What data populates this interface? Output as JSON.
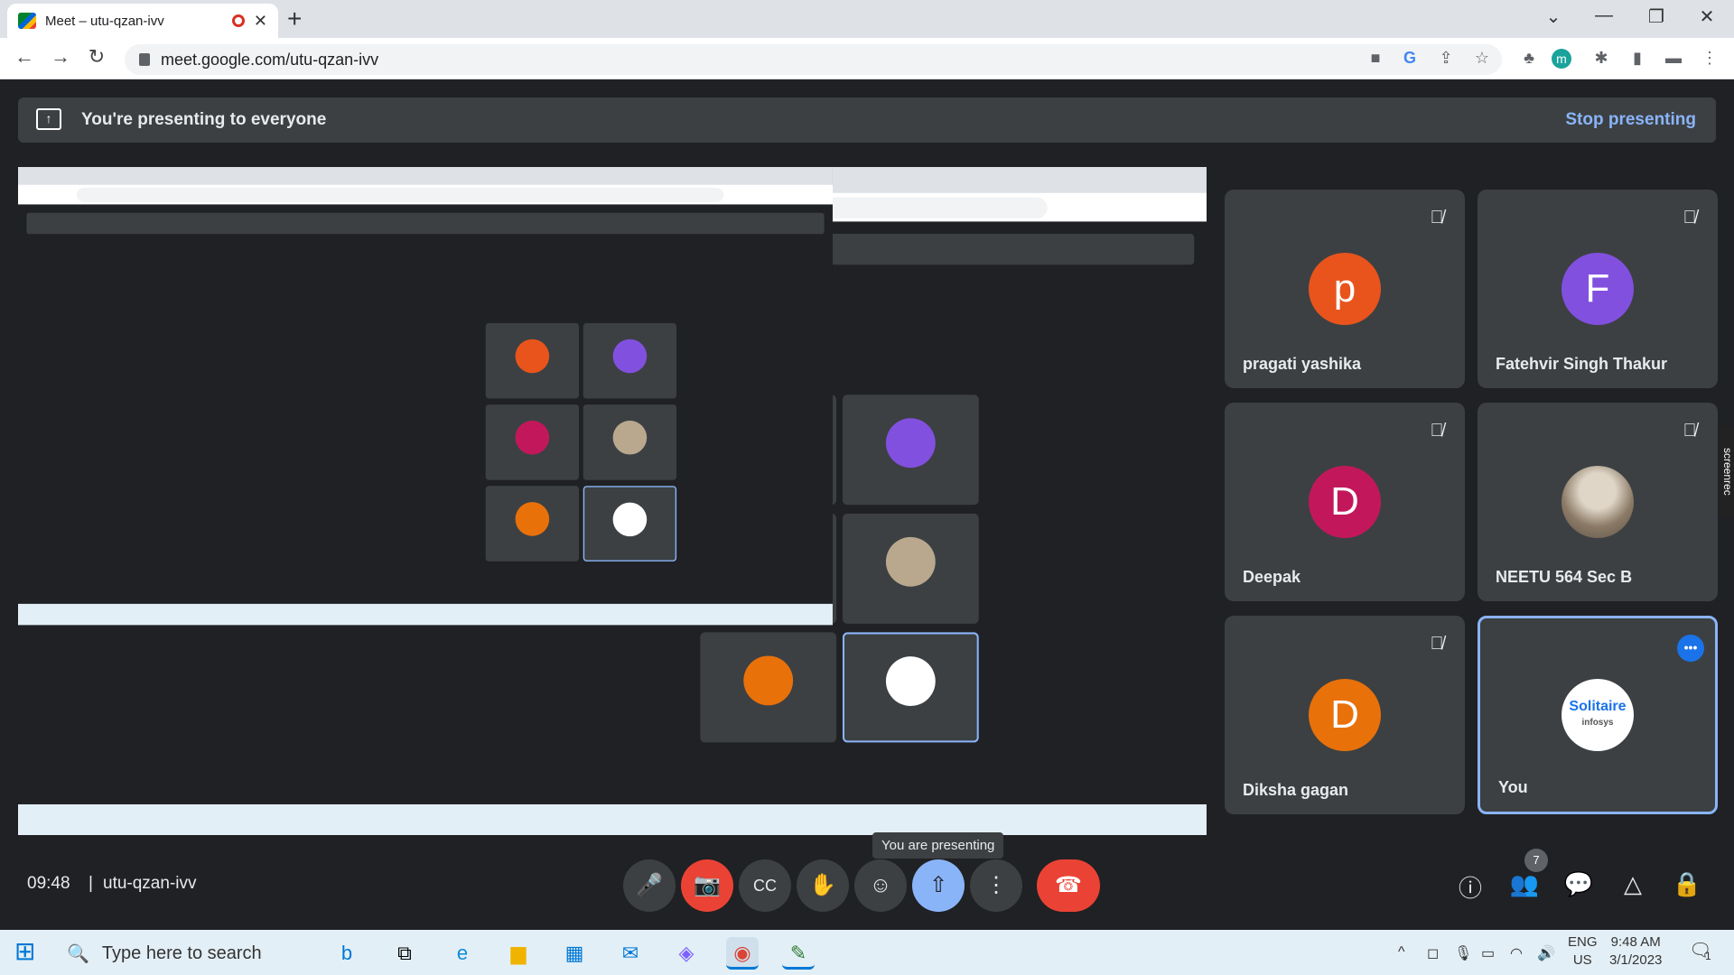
{
  "browser": {
    "tab_title": "Meet – utu-qzan-ivv",
    "url": "meet.google.com/utu-qzan-ivv"
  },
  "banner": {
    "text": "You're presenting to everyone",
    "stop": "Stop presenting"
  },
  "participants": [
    {
      "name": "pragati yashika",
      "initial": "p",
      "color": "#e8541c",
      "muted": true
    },
    {
      "name": "Fatehvir Singh Thakur",
      "initial": "F",
      "color": "#8250df",
      "muted": true
    },
    {
      "name": "Deepak",
      "initial": "D",
      "color": "#c2185b",
      "muted": true
    },
    {
      "name": "NEETU 564 Sec B",
      "initial": "",
      "color": "#b9a88e",
      "muted": true
    },
    {
      "name": "Diksha gagan",
      "initial": "D",
      "color": "#e8710a",
      "muted": true
    },
    {
      "name": "You",
      "initial": "",
      "color": "#ffffff",
      "muted": false
    }
  ],
  "you_logo": {
    "title": "Solitaire",
    "sub": "infosys"
  },
  "bottom": {
    "time": "09:48",
    "separator": "|",
    "meeting_code": "utu-qzan-ivv",
    "tooltip": "You are presenting",
    "people_count": "7"
  },
  "taskbar": {
    "search_placeholder": "Type here to search",
    "lang1": "ENG",
    "lang2": "US",
    "time": "9:48 AM",
    "date": "3/1/2023",
    "notifications": "1"
  },
  "screenrec": "screenrec"
}
